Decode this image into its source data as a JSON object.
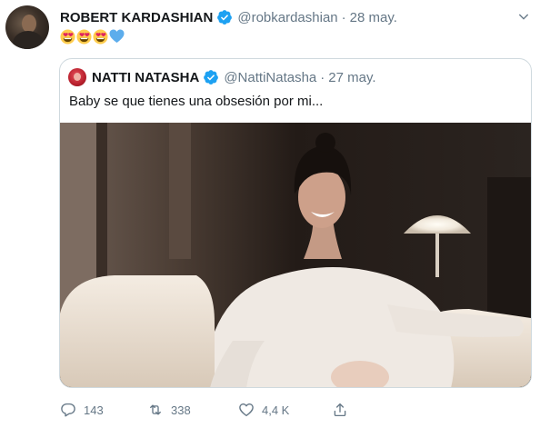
{
  "tweet": {
    "author_name": "ROBERT KARDASHIAN",
    "author_handle": "@robkardashian",
    "separator": "·",
    "date": "28 may.",
    "emoji_text": "😍😍😍💙"
  },
  "quoted": {
    "author_name": "NATTI NATASHA",
    "author_handle": "@NattiNatasha",
    "separator": "·",
    "date": "27 may.",
    "text": "Baby se que tienes una obsesión por mi..."
  },
  "actions": {
    "replies": "143",
    "retweets": "338",
    "likes": "4,4 K"
  },
  "colors": {
    "verified": "#1da1f2",
    "muted": "#657786",
    "border": "#cfd9de",
    "text": "#14171a"
  },
  "icons": [
    "verified-badge-icon",
    "chevron-down-icon",
    "reply-icon",
    "retweet-icon",
    "like-icon",
    "share-icon"
  ]
}
